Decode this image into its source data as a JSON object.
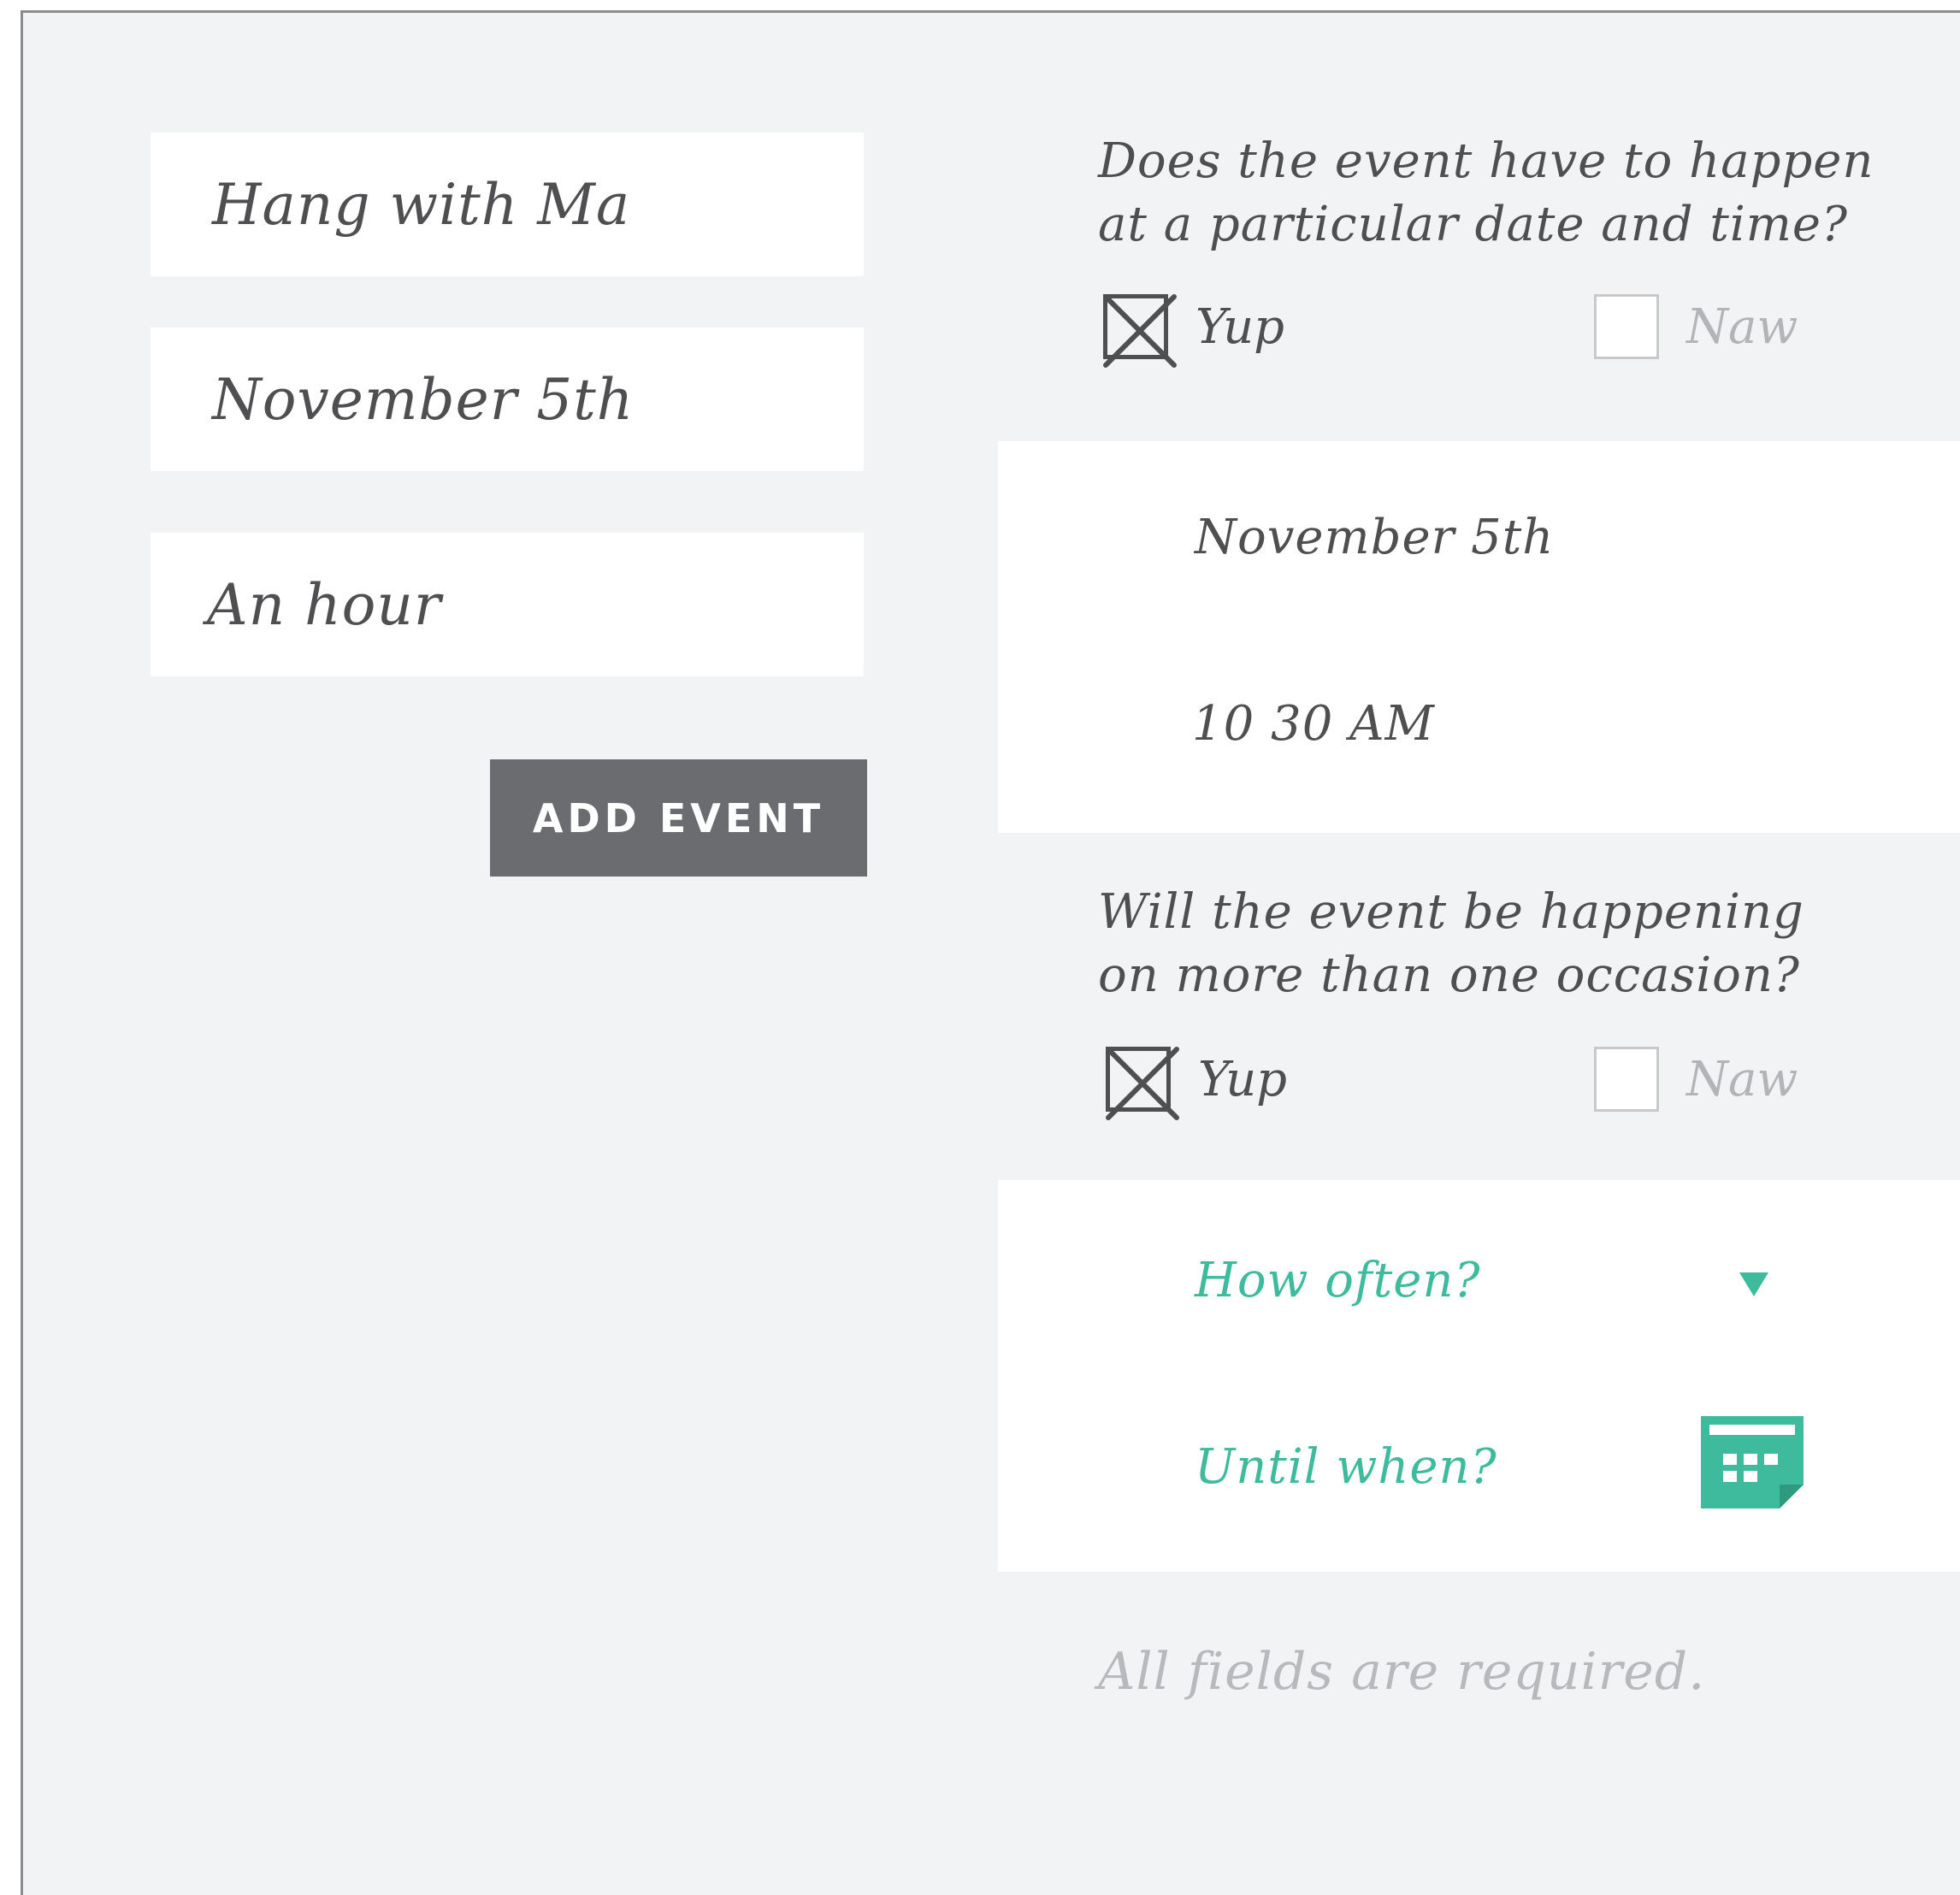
{
  "form": {
    "event_name": "Hang with Ma",
    "event_date": "November 5th",
    "event_duration": "An hour",
    "add_button_label": "ADD EVENT"
  },
  "question_fixed_time": {
    "line1": "Does the event have to happen",
    "line2": "at a particular date and time?",
    "yes_label": "Yup",
    "no_label": "Naw",
    "selected": "yes"
  },
  "datetime_panel": {
    "date_value": "November 5th",
    "time_value": "10 30 AM"
  },
  "question_recurring": {
    "line1": "Will the event be happening",
    "line2": "on more than one occasion?",
    "yes_label": "Yup",
    "no_label": "Naw",
    "selected": "yes"
  },
  "recurrence_panel": {
    "frequency_placeholder": "How often?",
    "until_placeholder": "Until when?",
    "frequency_icon": "caret-down-icon",
    "until_icon": "calendar-icon"
  },
  "footnote": "All fields are required.",
  "colors": {
    "accent": "#3dbb9c",
    "text": "#4f4f51",
    "muted": "#b3b4b7",
    "button": "#6b6c6f",
    "background": "#f2f3f5"
  }
}
